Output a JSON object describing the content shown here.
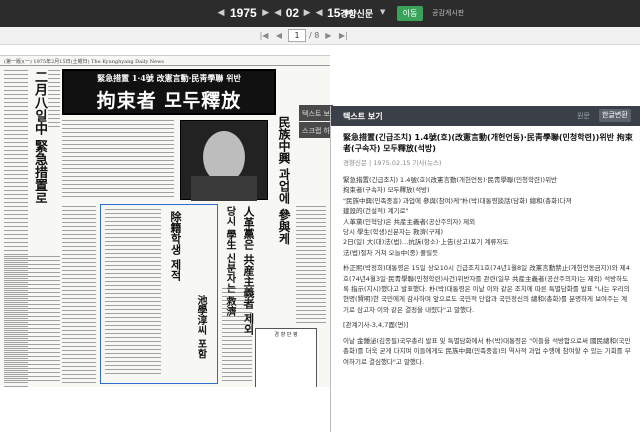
{
  "date": {
    "year": "1975",
    "month": "02",
    "day": "15"
  },
  "paper_name": "경향신문",
  "move_button": "이동",
  "board_link": "공감게시판",
  "pager": {
    "current": "1",
    "total": "/ 8"
  },
  "side_tabs": [
    "텍스트 보기",
    "스크랩 하기"
  ],
  "newspaper": {
    "strip": "(第一版)(一) 1975年2月15日(土曜日)    The Kyunghyang Daily News",
    "headline_sub": "緊急措置 1·4號 改憲言動·民靑學聯 위반",
    "headline_main": "拘束者 모두釋放",
    "vertical_heads": [
      "民族中興 과업에 參與케",
      "人革黨은 共産主義者 제외",
      "당시 學生 신분자는 救濟",
      "二月八일中 緊急措置로",
      "除籍학생 제적",
      "池學淳씨 포함"
    ],
    "cartoon_title": "경 향 만 평"
  },
  "text_panel": {
    "title": "텍스트 보기",
    "original_label": "원문",
    "korean_label": "한글변환",
    "article_title": "緊急措置(긴급조치) 1.4號(호)(改憲言動(개헌언동)·民靑學聯(민청학련))위반 拘束者(구속자) 모두釋放(석방)",
    "meta": "경향신문 | 1975.02.15 기사(뉴스)",
    "summary": [
      "緊急措置(긴급조치) 1.4號(호)(改憲言動(개헌언동)·民靑學聯(민청학련))위반",
      "拘束者(구속자) 모두釋放(석방)",
      "\"民族中興(민족중흥) 과업에 參與(참여)케\"朴(박)대통령談話(담화) 總和(총화)다져",
      "建設的(건설적) 계기로\"",
      "人革黨(인혁당)은 共産主義者(공산주의자) 제외",
      "당시 學生(학생)신분자는 救濟(구제)",
      "2日(일) 大(대)法(법)…抗訴(항소)·上告(상고)포기 계류자도",
      "法(법)절차 거쳐 오늘中(중) 풀릴듯"
    ],
    "paragraphs": [
      "朴正熙(박정희)대통령은 15일 상오10시 긴급조치1호(74년1월8일 改憲言動禁止(개헌언동금지))와 제4호(74년4월3일·民靑學聯(민청학련)사건)위반자를 관련(일부 共産主義者(공산주의자)는 제외) 석방하도록 指示(지시)했다고 발표했다. 朴(박)대통령은 이날 이와 같은 조치에 따른 특별담화를 발표 \"나는 우리의 현명(賢明)한 국민에게 감사하며 앞으로도 국민적 단합과 국민정신의 總和(총화)를 분명하게 보여주는 계기로 삼고자 이와 같은 결정을 내렸다\"고 말했다.",
      "[관계기사-3,4,7面(면)]",
      "이날 金鍾泌(김종필)국무총리 발표 및 특별담화에서 朴(박)대통령은 \"이들을 석방함으로써 國民總和(국민총화)를 더욱 굳게 다지며 이들에게도 民族中興(민족중흥)의 역사적 과업 수행에 참여할 수 있는 기회를 부여하기로 결심했다\"고 말했다."
    ]
  }
}
